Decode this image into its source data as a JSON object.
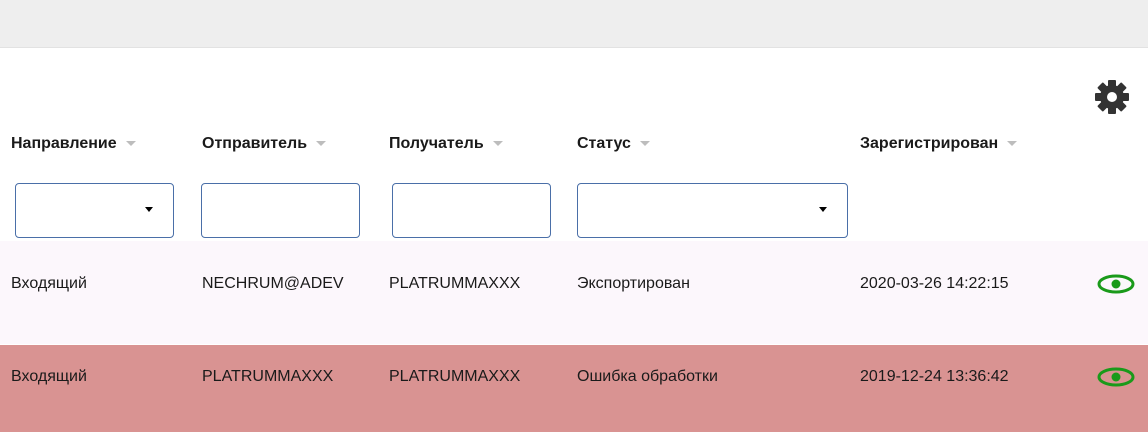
{
  "table": {
    "columns": [
      {
        "label": "Направление"
      },
      {
        "label": "Отправитель"
      },
      {
        "label": "Получатель"
      },
      {
        "label": "Статус"
      },
      {
        "label": "Зарегистрирован"
      }
    ],
    "filters": {
      "direction": "",
      "sender": "",
      "receiver": "",
      "status": ""
    },
    "rows": [
      {
        "direction": "Входящий",
        "sender": "NECHRUM@ADEV",
        "receiver": "PLATRUMMAXXX",
        "status": "Экспортирован",
        "registered": "2020-03-26 14:22:15"
      },
      {
        "direction": "Входящий",
        "sender": "PLATRUMMAXXX",
        "receiver": "PLATRUMMAXXX",
        "status": "Ошибка обработки",
        "registered": "2019-12-24 13:36:42"
      }
    ]
  },
  "icons": {
    "settings": "gear-icon",
    "view": "eye-icon"
  },
  "colors": {
    "error_row": "#d99392",
    "normal_row": "#fcf7fc",
    "eye_icon": "#1a9a1a",
    "filter_border": "#4a6fa8"
  }
}
